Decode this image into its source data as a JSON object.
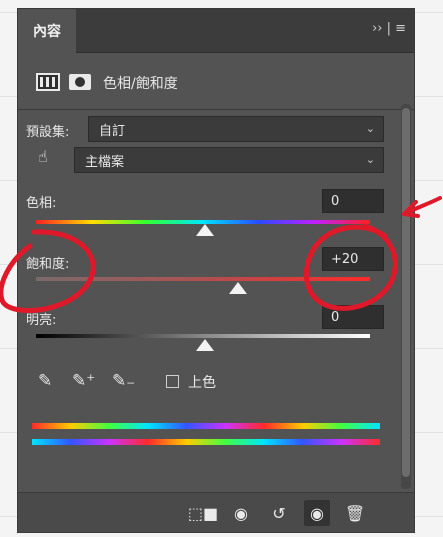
{
  "tab": {
    "label": "內容",
    "menu_icon": "panel-menu"
  },
  "header": {
    "title": "色相/飽和度",
    "icons": [
      "adjustment-layer-icon",
      "mask-icon"
    ]
  },
  "preset": {
    "label": "預設集:",
    "value": "自訂"
  },
  "channel": {
    "value": "主檔案",
    "icon": "targeted-adjustment-hand-icon"
  },
  "hue": {
    "label": "色相:",
    "value": "0"
  },
  "saturation": {
    "label": "飽和度:",
    "value": "+20"
  },
  "lightness": {
    "label": "明亮:",
    "value": "0"
  },
  "colorize": {
    "label": "上色",
    "checked": false
  },
  "tools": [
    "eyedropper-icon",
    "eyedropper-add-icon",
    "eyedropper-subtract-icon"
  ],
  "footer": [
    "clip-to-layer-icon",
    "view-previous-state-icon",
    "reset-icon",
    "visibility-icon",
    "delete-icon"
  ],
  "colors": {
    "panel": "#535353",
    "annotation": "#e0192a"
  }
}
